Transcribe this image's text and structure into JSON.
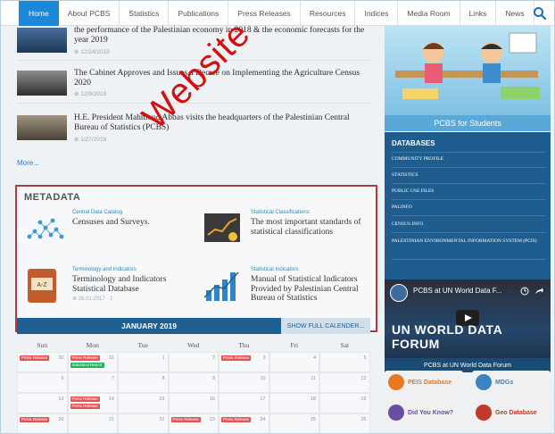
{
  "nav": {
    "items": [
      "Home",
      "About PCBS",
      "Statistics",
      "Publications",
      "Press Releases",
      "Resources",
      "Indices",
      "Media Room",
      "Links",
      "News"
    ],
    "active_index": 0,
    "search_icon": "search-icon"
  },
  "news": [
    {
      "title": "the performance of the Palestinian economy in 2018 & the economic forecasts for the year 2019",
      "date": "12/24/2018"
    },
    {
      "title": "The Cabinet Approves and Issues a Decree on Implementing the Agriculture Census 2020",
      "date": "12/9/2019"
    },
    {
      "title": "H.E. President Mahmoud Abbas visits the headquarters of the Palestinian Central Bureau of Statistics (PCBS)",
      "date": "1/27/2019"
    }
  ],
  "more_label": "More...",
  "metadata": {
    "title": "METADATA",
    "cards": [
      {
        "category": "Central Data Catalog",
        "name": "Censuses and Surveys.",
        "info": ""
      },
      {
        "category": "Statistical Classifications",
        "name": "The most important standards of statistical classifications",
        "info": ""
      },
      {
        "category": "Terminology and Indicators",
        "name": "Terminology and Indicators Statistical Database",
        "info": "26.01.2017 · 1"
      },
      {
        "category": "Statistical Indicators",
        "name": "Manual of Statistical Indicators Provided by Palestinian Central Bureau of Statistics",
        "info": ""
      }
    ]
  },
  "calendar": {
    "month": "JANUARY 2019",
    "full_label": "SHOW FULL CALENDER...",
    "days": [
      "Sun",
      "Mon",
      "Tue",
      "Wed",
      "Thu",
      "Fri",
      "Sat"
    ],
    "rows": [
      [
        {
          "n": "30",
          "e": [
            "Press Release"
          ]
        },
        {
          "n": "31",
          "e": [
            "Press Release",
            "Statistical Report"
          ]
        },
        {
          "n": "1",
          "e": []
        },
        {
          "n": "2",
          "e": []
        },
        {
          "n": "3",
          "e": [
            "Press Release"
          ]
        },
        {
          "n": "4",
          "e": []
        },
        {
          "n": "5",
          "e": []
        }
      ],
      [
        {
          "n": "6",
          "e": []
        },
        {
          "n": "7",
          "e": []
        },
        {
          "n": "8",
          "e": []
        },
        {
          "n": "9",
          "e": []
        },
        {
          "n": "10",
          "e": []
        },
        {
          "n": "11",
          "e": []
        },
        {
          "n": "12",
          "e": []
        }
      ],
      [
        {
          "n": "13",
          "e": []
        },
        {
          "n": "14",
          "e": [
            "Press Release",
            "Press Release"
          ]
        },
        {
          "n": "15",
          "e": []
        },
        {
          "n": "16",
          "e": []
        },
        {
          "n": "17",
          "e": []
        },
        {
          "n": "18",
          "e": []
        },
        {
          "n": "19",
          "e": []
        }
      ],
      [
        {
          "n": "20",
          "e": [
            "Press Release"
          ]
        },
        {
          "n": "21",
          "e": []
        },
        {
          "n": "22",
          "e": []
        },
        {
          "n": "23",
          "e": [
            "Press Release"
          ]
        },
        {
          "n": "24",
          "e": [
            "Press Release"
          ]
        },
        {
          "n": "25",
          "e": []
        },
        {
          "n": "26",
          "e": []
        }
      ]
    ]
  },
  "students_label": "PCBS for Students",
  "databases": {
    "title": "DATABASES",
    "items": [
      "Community Profile",
      "Statistics",
      "Public Use Files",
      "PALINFO",
      "Census Info",
      "Palestinian Environmental Information System (PCIS)"
    ]
  },
  "video": {
    "title": "PCBS at UN World Data F...",
    "banner": "UN WORLD DATA FORUM",
    "caption": "PCBS at UN World Data Forum"
  },
  "badges": [
    {
      "label": "PEIS Database",
      "color": "#e87722"
    },
    {
      "label": "MDGs",
      "color": "#3b84c4"
    },
    {
      "label": "Did You Know?",
      "color": "#6a4ca1"
    },
    {
      "label": "Geo Database",
      "color": "#c0392b"
    }
  ],
  "watermark": "Website",
  "colors": {
    "nav_active": "#1e88d8",
    "db_bg": "#1e5d8d",
    "calendar_head": "#1f5f92",
    "metadata_border": "#b23a3a",
    "press_release": "#e25555",
    "stat_report": "#27ae60"
  }
}
